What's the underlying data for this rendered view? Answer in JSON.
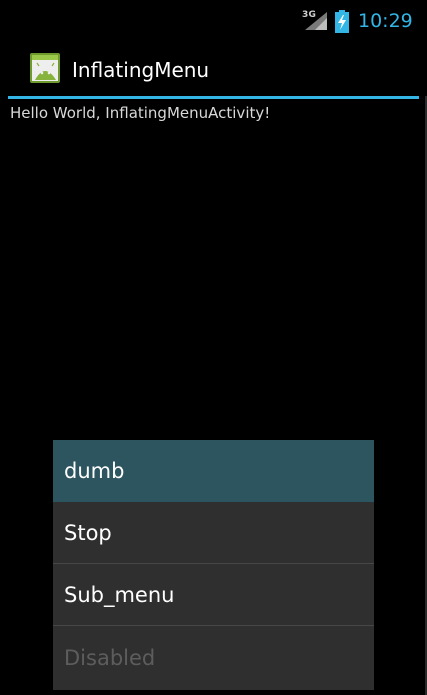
{
  "status_bar": {
    "network": "3G",
    "time": "10:29",
    "colors": {
      "clock": "#33b5e5"
    },
    "icons": [
      "signal-icon",
      "battery-icon"
    ]
  },
  "action_bar": {
    "title": "InflatingMenu",
    "icon": "android-app-icon",
    "accent_color": "#33b5e5"
  },
  "content": {
    "text": "Hello World, InflatingMenuActivity!"
  },
  "menu": {
    "items": [
      {
        "label": "dumb",
        "state": "selected"
      },
      {
        "label": "Stop",
        "state": "normal"
      },
      {
        "label": "Sub_menu",
        "state": "normal"
      },
      {
        "label": "Disabled",
        "state": "disabled"
      }
    ],
    "colors": {
      "panel": "#2f2f2f",
      "selected": "#2d5560",
      "disabled_text": "#5d5d5d"
    }
  }
}
